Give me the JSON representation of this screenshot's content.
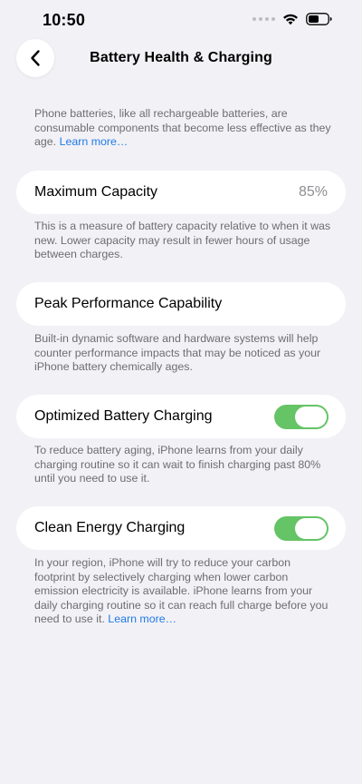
{
  "status_bar": {
    "time": "10:50"
  },
  "nav": {
    "title": "Battery Health & Charging"
  },
  "intro": {
    "text": "Phone batteries, like all rechargeable batteries, are consumable components that become less effective as they age. ",
    "link": "Learn more…"
  },
  "max_capacity": {
    "label": "Maximum Capacity",
    "value": "85%",
    "note": "This is a measure of battery capacity relative to when it was new. Lower capacity may result in fewer hours of usage between charges."
  },
  "peak_performance": {
    "label": "Peak Performance Capability",
    "note": "Built-in dynamic software and hardware systems will help counter performance impacts that may be noticed as your iPhone battery chemically ages."
  },
  "optimized_charging": {
    "label": "Optimized Battery Charging",
    "enabled": true,
    "note": "To reduce battery aging, iPhone learns from your daily charging routine so it can wait to finish charging past 80% until you need to use it."
  },
  "clean_energy": {
    "label": "Clean Energy Charging",
    "enabled": true,
    "note": "In your region, iPhone will try to reduce your carbon footprint by selectively charging when lower carbon emission electricity is available. iPhone learns from your daily charging routine so it can reach full charge before you need to use it. ",
    "link": "Learn more…"
  },
  "colors": {
    "toggle_on": "#65c466",
    "link": "#1f7be6",
    "background": "#f2f1f6"
  },
  "icons": [
    "chevron-left-icon",
    "cellular-dots-icon",
    "wifi-icon",
    "battery-icon"
  ]
}
